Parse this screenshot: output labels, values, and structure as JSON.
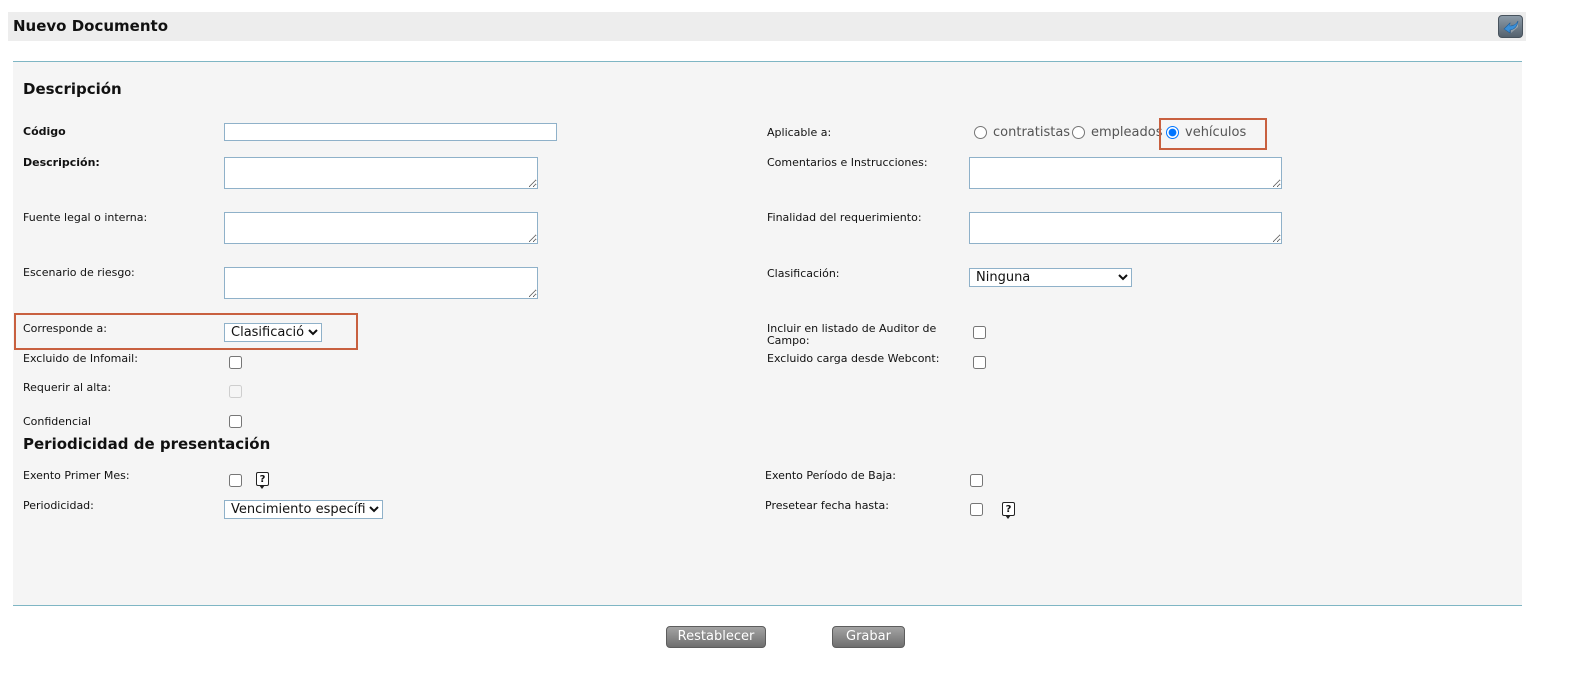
{
  "header": {
    "title": "Nuevo Documento",
    "back_icon": "back-arrow-icon"
  },
  "sections": {
    "description_title": "Descripción",
    "periodicity_title": "Periodicidad de presentación"
  },
  "fields": {
    "codigo": {
      "label": "Código",
      "value": ""
    },
    "descripcion": {
      "label": "Descripción:",
      "value": ""
    },
    "fuente_legal": {
      "label": "Fuente legal o interna:",
      "value": ""
    },
    "escenario_riesgo": {
      "label": "Escenario de riesgo:",
      "value": ""
    },
    "corresponde_a": {
      "label": "Corresponde a:",
      "selected": "Clasificación"
    },
    "excluido_infomail": {
      "label": "Excluido de Infomail:",
      "checked": false
    },
    "requerir_alta": {
      "label": "Requerir al alta:",
      "checked": false,
      "disabled": true
    },
    "confidencial": {
      "label": "Confidencial",
      "checked": false
    },
    "aplicable_a": {
      "label": "Aplicable a:",
      "options": [
        "contratistas",
        "empleados",
        "vehículos"
      ],
      "selected": "vehículos"
    },
    "comentarios": {
      "label": "Comentarios e Instrucciones:",
      "value": ""
    },
    "finalidad": {
      "label": "Finalidad del requerimiento:",
      "value": ""
    },
    "clasificacion": {
      "label": "Clasificación:",
      "selected": "Ninguna"
    },
    "incluir_auditor": {
      "label": "Incluir en listado de Auditor de Campo:",
      "checked": false
    },
    "excluido_webcont": {
      "label": "Excluido carga desde Webcont:",
      "checked": false
    },
    "exento_primer_mes": {
      "label": "Exento Primer Mes:",
      "checked": false
    },
    "periodicidad": {
      "label": "Periodicidad:",
      "selected": "Vencimiento específico"
    },
    "exento_periodo_baja": {
      "label": "Exento Período de Baja:",
      "checked": false
    },
    "presetear_fecha": {
      "label": "Presetear fecha hasta:",
      "checked": false
    }
  },
  "help_glyph": "?",
  "buttons": {
    "reset": "Restablecer",
    "save": "Grabar"
  },
  "colors": {
    "highlight": "#c8603f",
    "panel_border": "#7fb6c4",
    "input_border": "#8fb1c9"
  }
}
